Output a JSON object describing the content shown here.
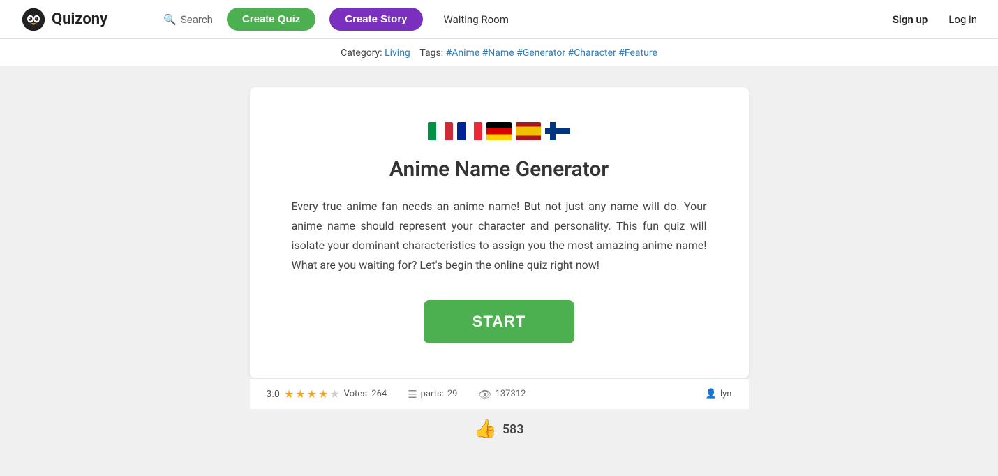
{
  "header": {
    "logo_text": "Quizony",
    "search_label": "Search",
    "create_quiz_label": "Create Quiz",
    "create_story_label": "Create Story",
    "waiting_room_label": "Waiting Room",
    "sign_up_label": "Sign up",
    "log_in_label": "Log in"
  },
  "sub_header": {
    "category_label": "Category:",
    "category_value": "Living",
    "tags_label": "Tags:",
    "tags": [
      "#Anime",
      "#Name",
      "#Generator",
      "#Character",
      "#Feature"
    ]
  },
  "quiz_card": {
    "title": "Anime Name Generator",
    "description": "Every true anime fan needs an anime name! But not just any name will do. Your anime name should represent your character and personality. This fun quiz will isolate your dominant characteristics to assign you the most amazing anime name! What are you waiting for? Let's begin the online quiz right now!",
    "start_label": "START",
    "flags": [
      {
        "code": "it",
        "label": "Italy flag"
      },
      {
        "code": "fr",
        "label": "France flag"
      },
      {
        "code": "de",
        "label": "Germany flag"
      },
      {
        "code": "es",
        "label": "Spain flag"
      },
      {
        "code": "fi",
        "label": "Finland flag"
      }
    ]
  },
  "stats": {
    "rating": "3.0",
    "votes_label": "Votes: 264",
    "parts_label": "parts:",
    "parts_count": "29",
    "views_count": "137312",
    "author": "lyn"
  },
  "likes": {
    "count": "583"
  },
  "colors": {
    "green": "#4caf50",
    "purple": "#7b2fbe",
    "star_filled": "#f5a623",
    "star_empty": "#ccc"
  }
}
